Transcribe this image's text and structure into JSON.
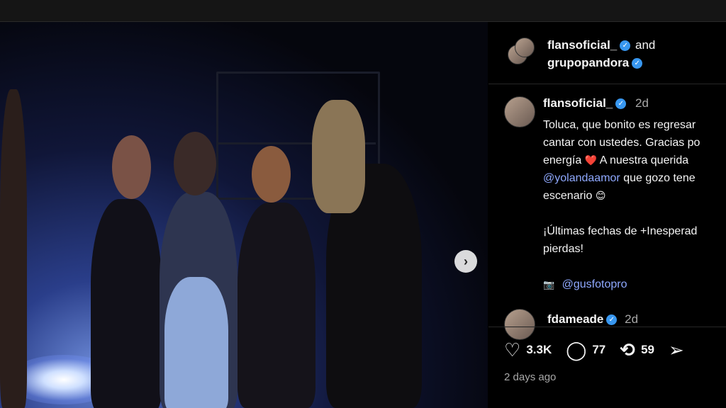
{
  "header": {
    "user1": "flansoficial_",
    "and_text": "and",
    "user2": "grupopandora"
  },
  "caption": {
    "username": "flansoficial_",
    "time": "2d",
    "lines": [
      "Toluca, que bonito es regresar",
      "cantar con ustedes. Gracias po",
      "energía",
      "A nuestra querida",
      "@yolandaamor",
      "que gozo tene",
      "escenario",
      "¡Últimas fechas de +Inesperad",
      "pierdas!",
      "@gusfotopro"
    ]
  },
  "comment": {
    "username": "fdameade",
    "time": "2d"
  },
  "actions": {
    "likes": "3.3K",
    "comments": "77",
    "reposts": "59"
  },
  "footer": {
    "date": "2 days ago"
  },
  "icons": {
    "verified": "verified-badge",
    "heart_emoji": "❤️",
    "smile_emoji": "😊",
    "camera_emoji": "📷"
  },
  "colors": {
    "verified": "#3897f0",
    "mention": "#8fa9ff",
    "background": "#000000"
  }
}
